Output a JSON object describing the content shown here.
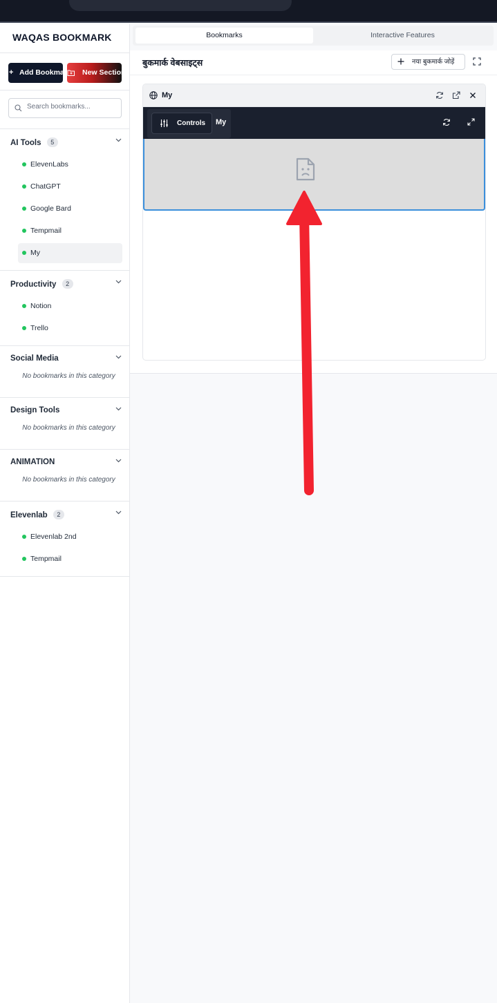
{
  "app": {
    "brand": "WAQAS BOOKMARK"
  },
  "sidebar": {
    "add_bookmark_label": "Add Bookmark",
    "new_section_label": "New Section",
    "search_placeholder": "Search bookmarks...",
    "sections": [
      {
        "name": "AI Tools",
        "count": "5",
        "items": [
          "ElevenLabs",
          "ChatGPT",
          "Google Bard",
          "Tempmail",
          "My"
        ],
        "active_item": "My"
      },
      {
        "name": "Productivity",
        "count": "2",
        "items": [
          "Notion",
          "Trello"
        ]
      },
      {
        "name": "Social Media",
        "empty_text": "No bookmarks in this category"
      },
      {
        "name": "Design Tools",
        "empty_text": "No bookmarks in this category"
      },
      {
        "name": "ANIMATION",
        "empty_text": "No bookmarks in this category"
      },
      {
        "name": "Elevenlab",
        "count": "2",
        "items": [
          "Elevenlab 2nd",
          "Tempmail"
        ]
      }
    ]
  },
  "tabs": {
    "bookmarks": "Bookmarks",
    "interactive": "Interactive Features"
  },
  "panel": {
    "title": "बुकमार्क वेबसाइट्स",
    "add_button": "नया बुकमार्क जोड़ें",
    "card": {
      "title": "My",
      "controls_label": "Controls",
      "dark_title": "My"
    }
  },
  "colors": {
    "accent_blue": "#3b8fdb",
    "dot_green": "#22c55e",
    "annotation_red": "#f2232f",
    "dark": "#0f172a"
  }
}
